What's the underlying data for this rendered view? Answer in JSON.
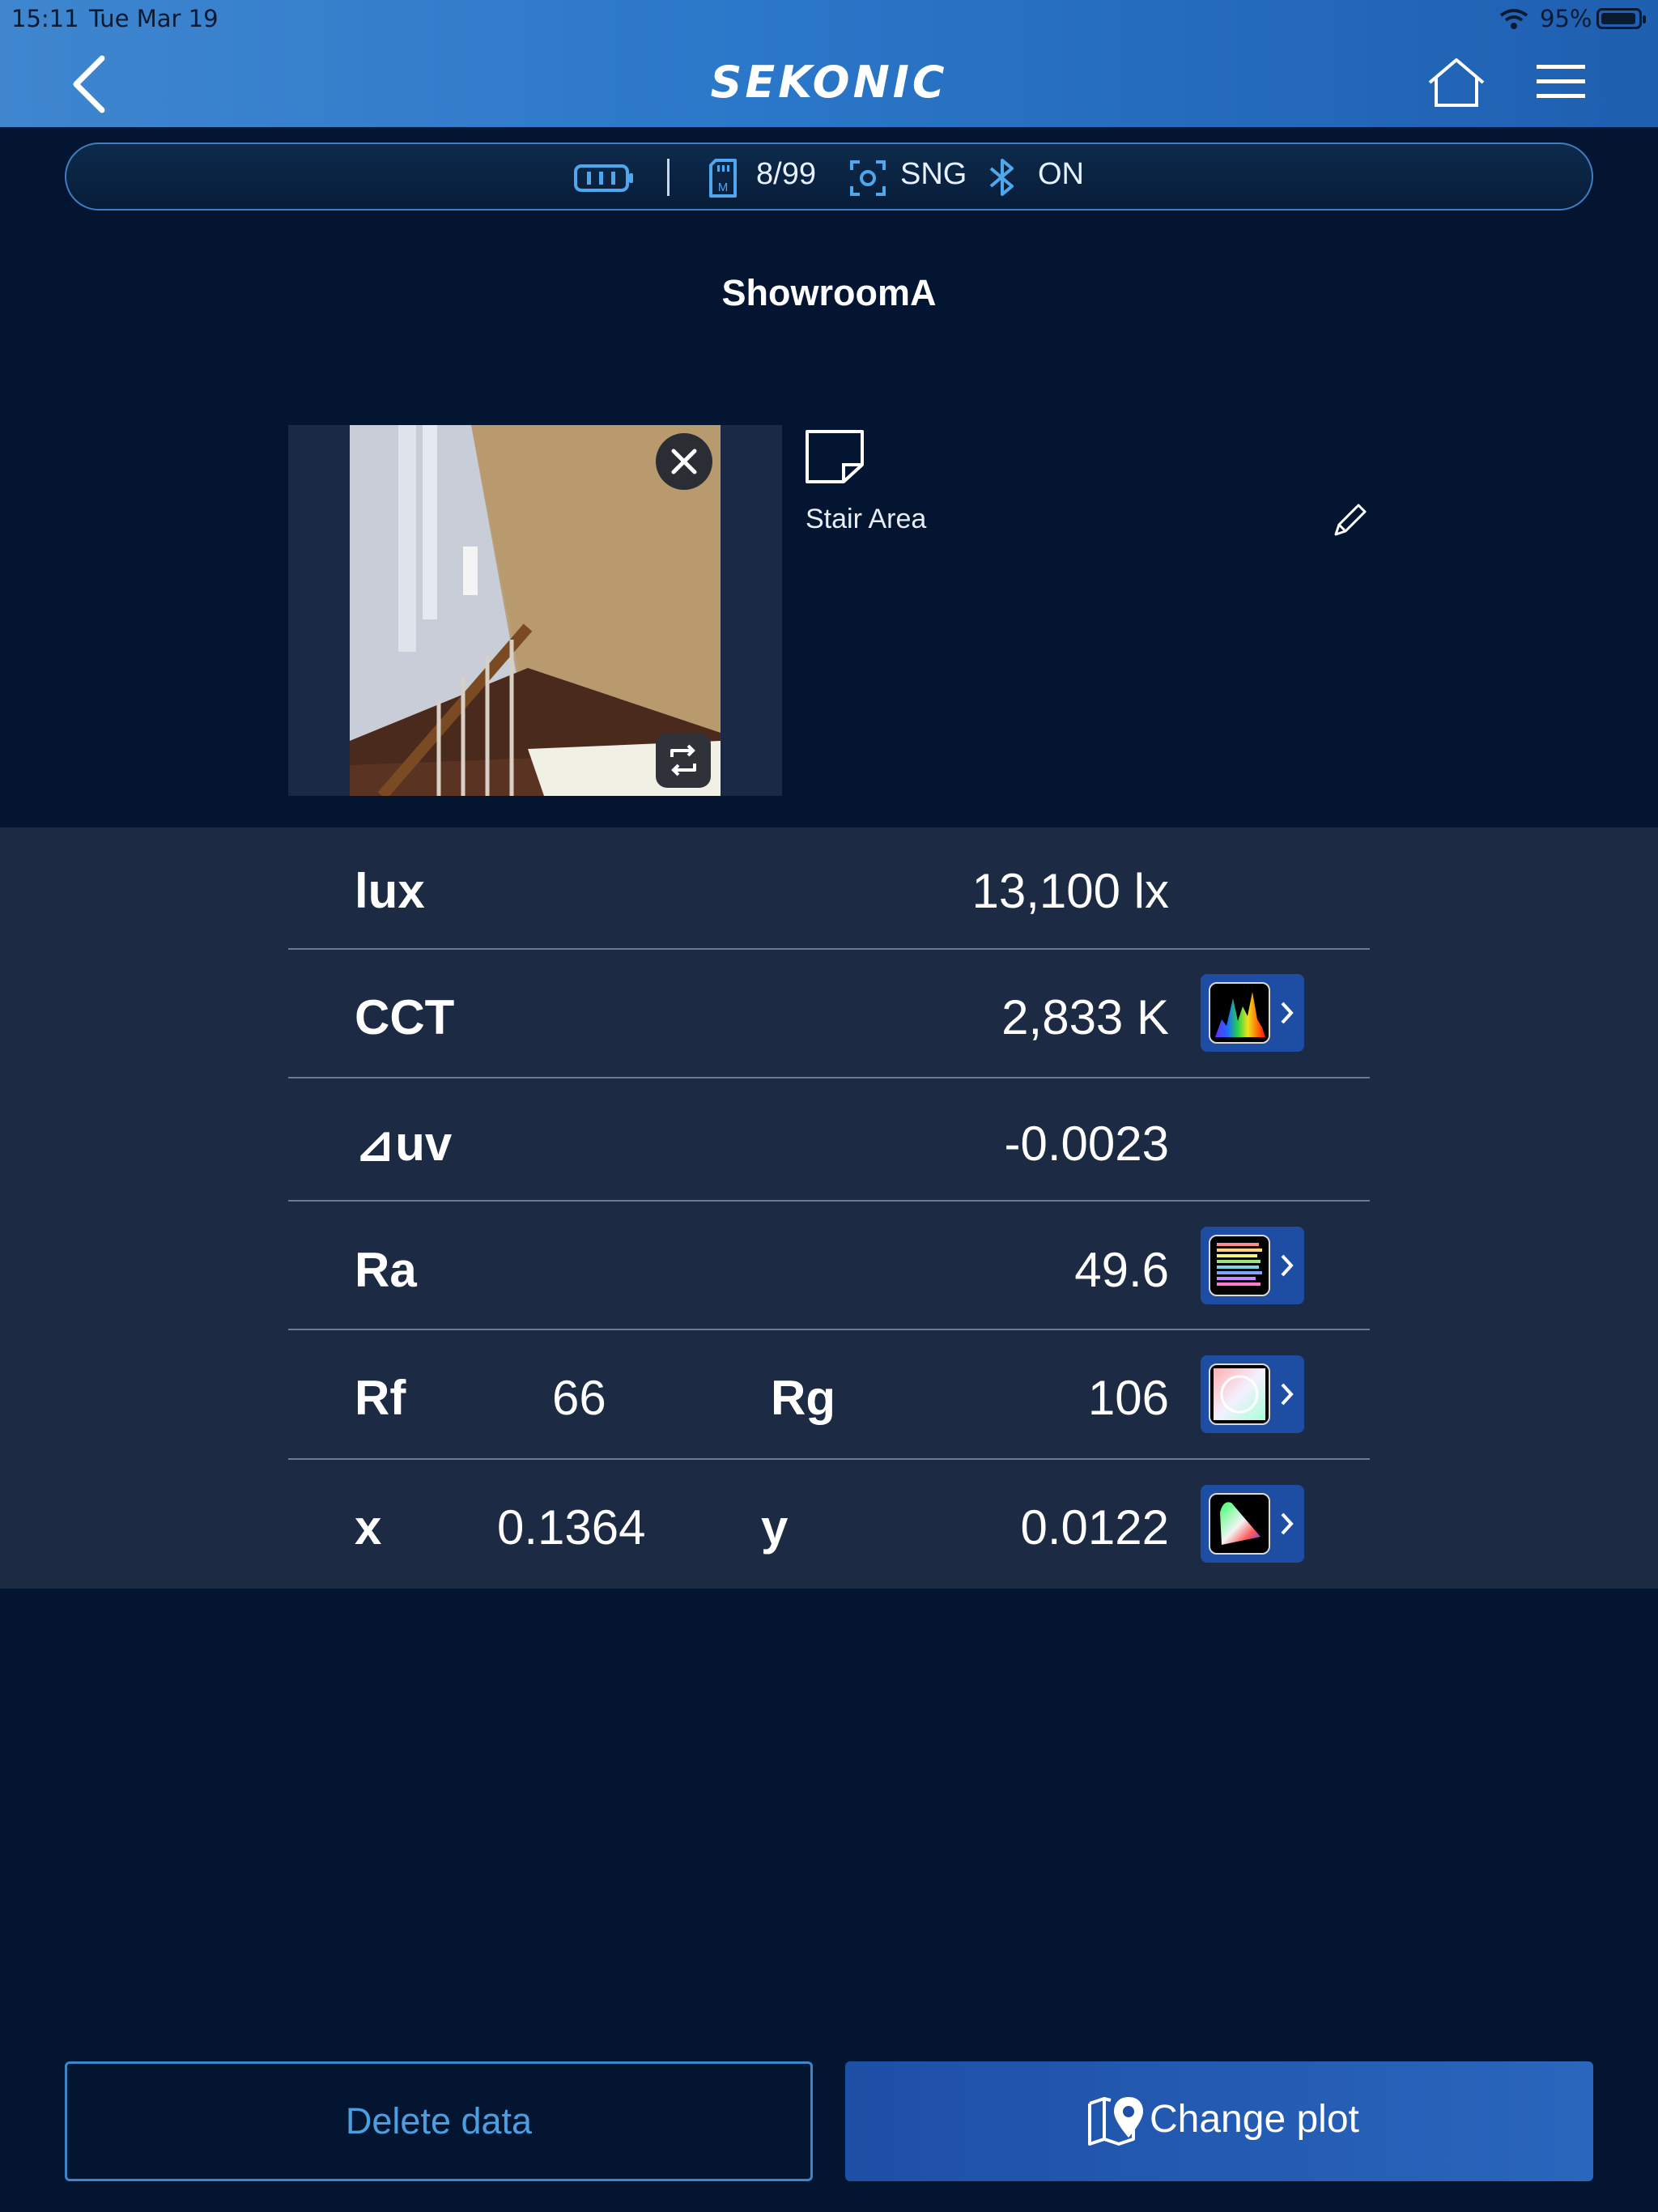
{
  "status_bar": {
    "time": "15:11",
    "date": "Tue Mar 19",
    "battery": "95%",
    "battery_level": 0.95
  },
  "header": {
    "brand": "SEKONIC"
  },
  "device": {
    "memory": "8/99",
    "mode": "SNG",
    "bluetooth": "ON"
  },
  "page": {
    "title": "ShowroomA"
  },
  "photo": {
    "memo": "Stair Area"
  },
  "measurements": {
    "lux": {
      "label": "lux",
      "value": "13,100 lx"
    },
    "cct": {
      "label": "CCT",
      "value": "2,833 K"
    },
    "duv": {
      "label": "⊿uv",
      "value": "-0.0023"
    },
    "ra": {
      "label": "Ra",
      "value": "49.6"
    },
    "rf": {
      "label": "Rf",
      "value": "66"
    },
    "rg": {
      "label": "Rg",
      "value": "106"
    },
    "x": {
      "label": "x",
      "value": "0.1364"
    },
    "y": {
      "label": "y",
      "value": "0.0122"
    }
  },
  "actions": {
    "delete": "Delete data",
    "change_plot": "Change plot"
  },
  "colors": {
    "accent": "#2b77c9",
    "background": "#031530",
    "panel": "#1c2a43",
    "button": "#1e4ea3"
  }
}
